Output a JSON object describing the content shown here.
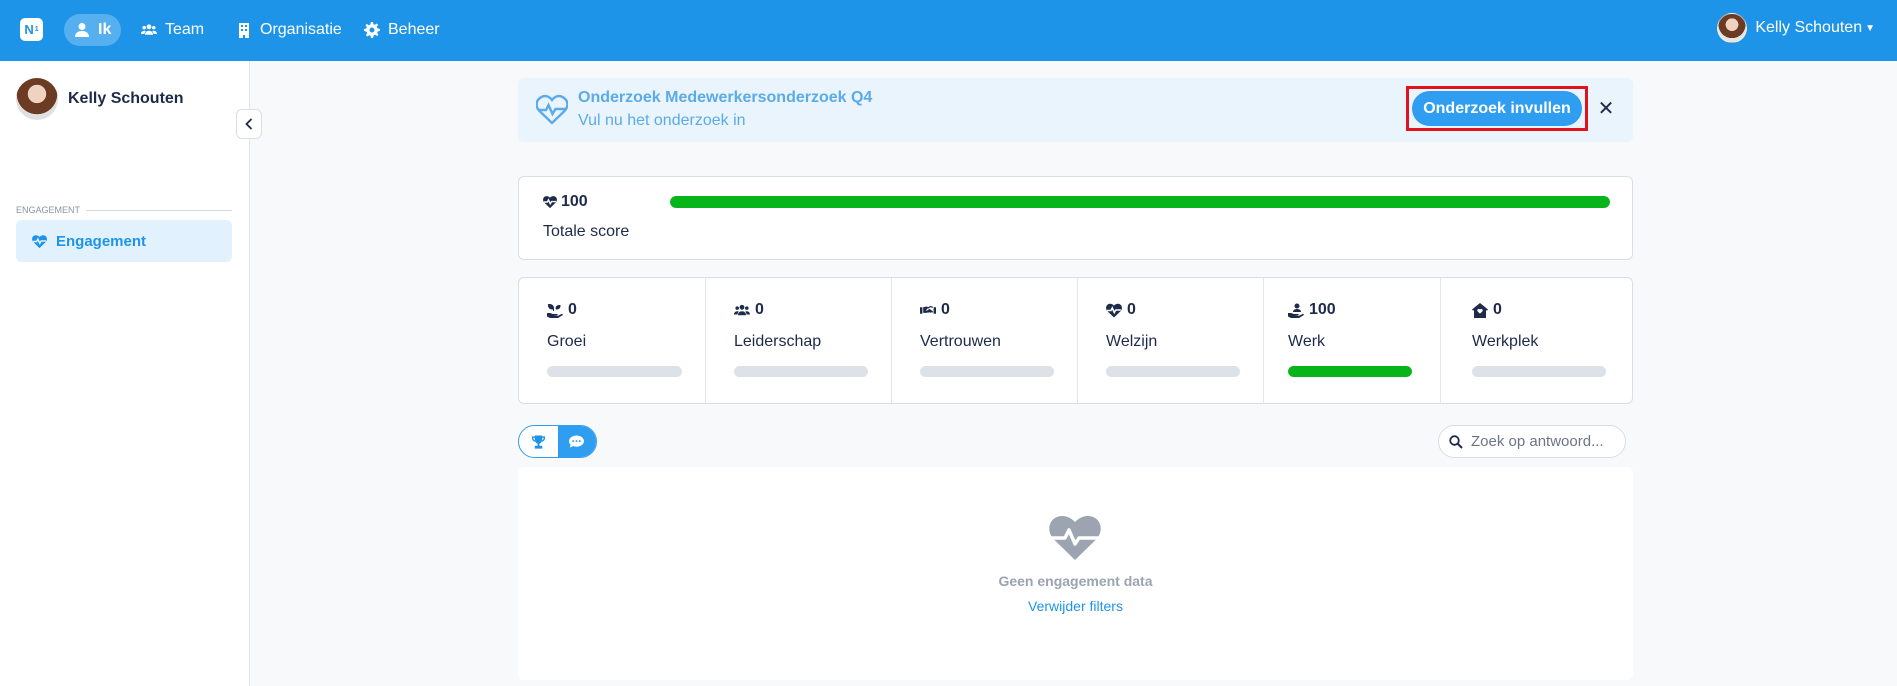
{
  "app": {
    "logo_text": "N",
    "logo_sup": "1"
  },
  "nav": {
    "items": [
      {
        "label": "Ik",
        "icon": "user-icon",
        "active": true
      },
      {
        "label": "Team",
        "icon": "users-icon",
        "active": false
      },
      {
        "label": "Organisatie",
        "icon": "building-icon",
        "active": false
      },
      {
        "label": "Beheer",
        "icon": "gear-icon",
        "active": false
      }
    ],
    "user_name": "Kelly Schouten"
  },
  "sidebar": {
    "user_name": "Kelly Schouten",
    "section_label": "Engagement",
    "items": [
      {
        "label": "Engagement",
        "icon": "heartbeat-icon",
        "active": true
      }
    ]
  },
  "banner": {
    "title": "Onderzoek Medewerkersonderzoek Q4",
    "subtitle": "Vul nu het onderzoek in",
    "button_label": "Onderzoek invullen",
    "close_label": "✕"
  },
  "total": {
    "value": "100",
    "label": "Totale score",
    "fill": 1.0
  },
  "categories": [
    {
      "value": "0",
      "label": "Groei",
      "icon": "seedling-hand-icon",
      "fill": 0
    },
    {
      "value": "0",
      "label": "Leiderschap",
      "icon": "users-icon",
      "fill": 0
    },
    {
      "value": "0",
      "label": "Vertrouwen",
      "icon": "handshake-icon",
      "fill": 0
    },
    {
      "value": "0",
      "label": "Welzijn",
      "icon": "heartbeat-icon",
      "fill": 0
    },
    {
      "value": "100",
      "label": "Werk",
      "icon": "hand-holding-user-icon",
      "fill": 1.0
    },
    {
      "value": "0",
      "label": "Werkplek",
      "icon": "house-icon",
      "fill": 0
    }
  ],
  "view_toggle": {
    "options": [
      "trophy-icon",
      "comment-icon"
    ],
    "selected": "comment-icon"
  },
  "search": {
    "placeholder": "Zoek op antwoord...",
    "value": ""
  },
  "empty_state": {
    "title": "Geen engagement data",
    "link": "Verwijder filters"
  },
  "colors": {
    "primary": "#1e94e9",
    "success": "#07b41a",
    "highlight": "#e0121b"
  }
}
